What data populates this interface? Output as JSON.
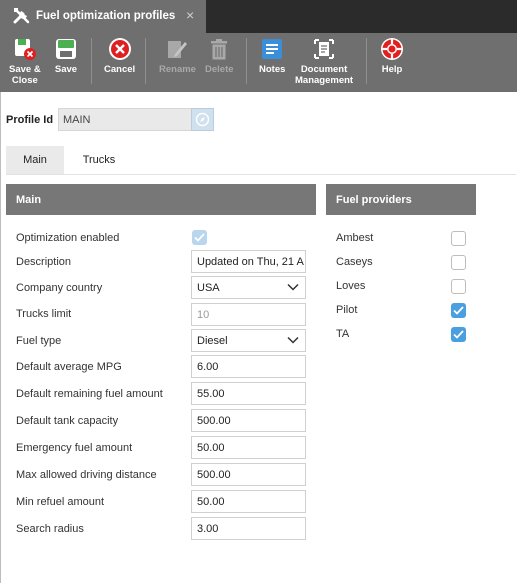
{
  "titlebar": {
    "title": "Fuel optimization profiles",
    "close": "×"
  },
  "toolbar": {
    "save_close": "Save &\nClose",
    "save": "Save",
    "cancel": "Cancel",
    "rename": "Rename",
    "delete": "Delete",
    "notes": "Notes",
    "document_management": "Document\nManagement",
    "help": "Help"
  },
  "profile": {
    "label": "Profile Id",
    "value": "MAIN"
  },
  "tabs": [
    {
      "label": "Main"
    },
    {
      "label": "Trucks"
    }
  ],
  "main": {
    "header": "Main",
    "rows": {
      "optimization_enabled": {
        "label": "Optimization enabled",
        "checked": true
      },
      "description": {
        "label": "Description",
        "value": "Updated on Thu, 21 A"
      },
      "company_country": {
        "label": "Company country",
        "value": "USA"
      },
      "trucks_limit": {
        "label": "Trucks limit",
        "value": "10"
      },
      "fuel_type": {
        "label": "Fuel type",
        "value": "Diesel"
      },
      "default_average_mpg": {
        "label": "Default average MPG",
        "value": "6.00"
      },
      "default_remaining_fuel": {
        "label": "Default remaining fuel amount",
        "value": "55.00"
      },
      "default_tank_capacity": {
        "label": "Default tank capacity",
        "value": "500.00"
      },
      "emergency_fuel": {
        "label": "Emergency fuel amount",
        "value": "50.00"
      },
      "max_driving_distance": {
        "label": "Max allowed driving distance",
        "value": "500.00"
      },
      "min_refuel": {
        "label": "Min refuel amount",
        "value": "50.00"
      },
      "search_radius": {
        "label": "Search radius",
        "value": "3.00"
      }
    }
  },
  "fuel_providers": {
    "header": "Fuel providers",
    "items": [
      {
        "label": "Ambest",
        "checked": false
      },
      {
        "label": "Caseys",
        "checked": false
      },
      {
        "label": "Loves",
        "checked": false
      },
      {
        "label": "Pilot",
        "checked": true
      },
      {
        "label": "TA",
        "checked": true
      }
    ]
  },
  "colors": {
    "toolbar_bg": "#6f6f6f",
    "titlebar_bg": "#2b2b2b",
    "section_header": "#777777",
    "checkbox_accent": "#4a9fe0",
    "cancel_red": "#e02020"
  }
}
